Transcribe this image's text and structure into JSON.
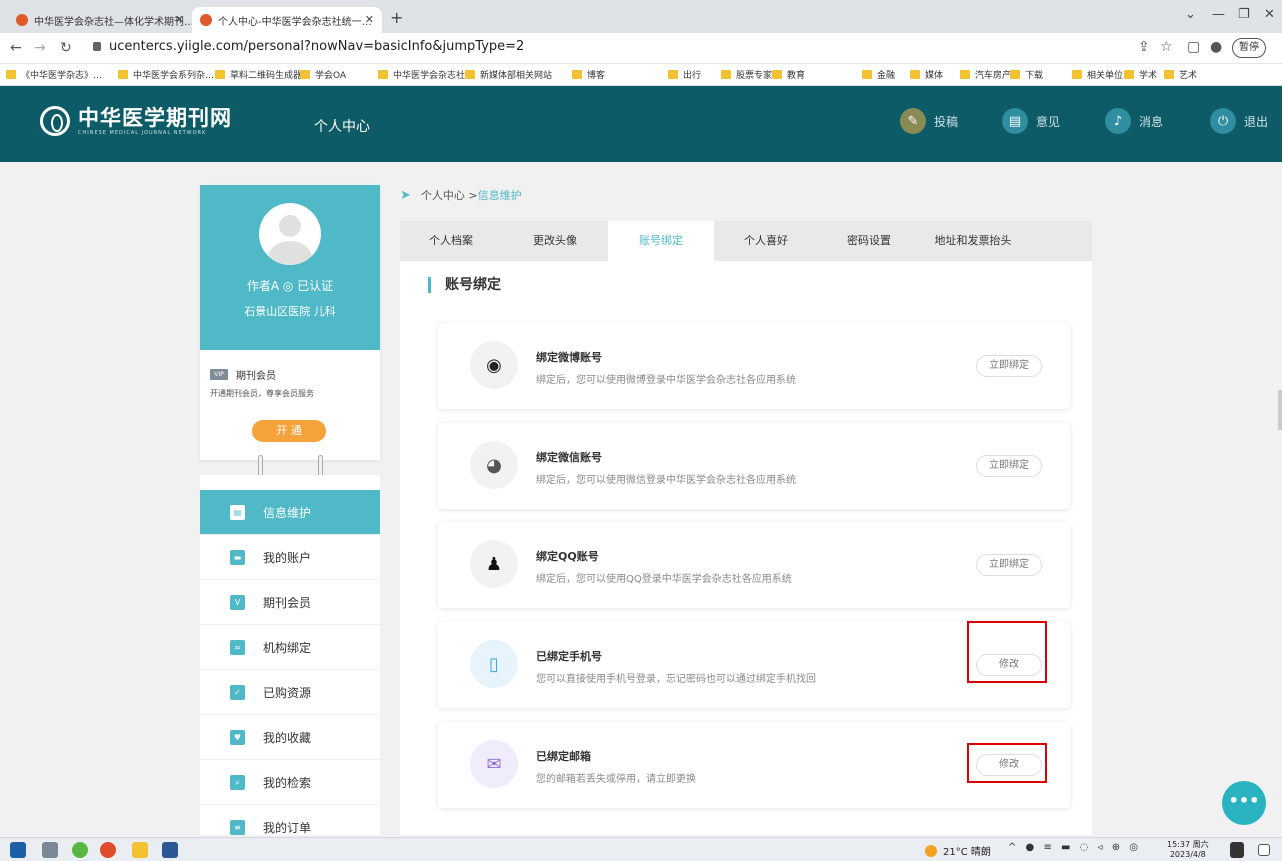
{
  "browser": {
    "tabs": [
      {
        "title": "中华医学会杂志社—体化学术期刊…"
      },
      {
        "title": "个人中心-中华医学会杂志社统一…"
      }
    ],
    "url": "ucentercs.yiigle.com/personal?nowNav=basicInfo&jumpType=2",
    "pause_label": "暂停",
    "bookmarks": [
      "《中华医学杂志》…",
      "中华医学会系列杂…",
      "草料二维码生成器",
      "学会OA",
      "中华医学会杂志社…",
      "新媒体部相关网站",
      "博客",
      "出行",
      "股票专家",
      "教育",
      "金融",
      "媒体",
      "汽车房产",
      "下载",
      "相关单位",
      "学术",
      "艺术"
    ]
  },
  "header": {
    "logo_main": "中华医学期刊网",
    "logo_sub": "CHINESE MEDICAL JOURNAL NETWORK",
    "title": "个人中心",
    "nav": [
      {
        "label": "投稿",
        "icon": "pen-icon",
        "color": "#8a8a55"
      },
      {
        "label": "意见",
        "icon": "feedback-icon",
        "color": "#2f8ea0"
      },
      {
        "label": "消息",
        "icon": "bell-icon",
        "color": "#2f8ea0"
      },
      {
        "label": "退出",
        "icon": "power-icon",
        "color": "#2f8ea0"
      }
    ]
  },
  "profile": {
    "name": "作者A ◎ 已认证",
    "hospital": "石景山区医院  儿科",
    "vip_badge": "VIP",
    "vip_title": "期刊会员",
    "vip_desc": "开通期刊会员，尊享会员服务",
    "open_button": "开 通"
  },
  "menu": [
    {
      "label": "信息维护",
      "icon": "id-card-icon",
      "active": true
    },
    {
      "label": "我的账户",
      "icon": "wallet-icon"
    },
    {
      "label": "期刊会员",
      "icon": "vip-icon"
    },
    {
      "label": "机构绑定",
      "icon": "link-icon"
    },
    {
      "label": "已购资源",
      "icon": "check-circle-icon"
    },
    {
      "label": "我的收藏",
      "icon": "heart-icon"
    },
    {
      "label": "我的检索",
      "icon": "search-icon"
    },
    {
      "label": "我的订单",
      "icon": "order-icon"
    }
  ],
  "breadcrumb": {
    "root": "个人中心 > ",
    "current": "信息维护"
  },
  "tabs": [
    "个人档案",
    "更改头像",
    "账号绑定",
    "个人喜好",
    "密码设置",
    "地址和发票抬头"
  ],
  "active_tab": "账号绑定",
  "section_title": "账号绑定",
  "bindings": [
    {
      "title": "绑定微博账号",
      "desc": "绑定后，您可以使用微博登录中华医学会杂志社各应用系统",
      "button": "立即绑定",
      "icon": "weibo-icon"
    },
    {
      "title": "绑定微信账号",
      "desc": "绑定后，您可以使用微信登录中华医学会杂志社各应用系统",
      "button": "立即绑定",
      "icon": "wechat-icon"
    },
    {
      "title": "绑定QQ账号",
      "desc": "绑定后，您可以使用QQ登录中华医学会杂志社各应用系统",
      "button": "立即绑定",
      "icon": "qq-icon"
    },
    {
      "title": "已绑定手机号",
      "desc": "您可以直接使用手机号登录，忘记密码也可以通过绑定手机找回",
      "button": "修改",
      "icon": "phone-icon"
    },
    {
      "title": "已绑定邮箱",
      "desc": "您的邮箱若丢失或停用，请立即更换",
      "button": "修改",
      "icon": "mail-icon"
    }
  ],
  "chat_button": "•••",
  "taskbar": {
    "weather": "21°C  晴朗",
    "time": "15:37 周六",
    "date": "2023/4/8"
  }
}
